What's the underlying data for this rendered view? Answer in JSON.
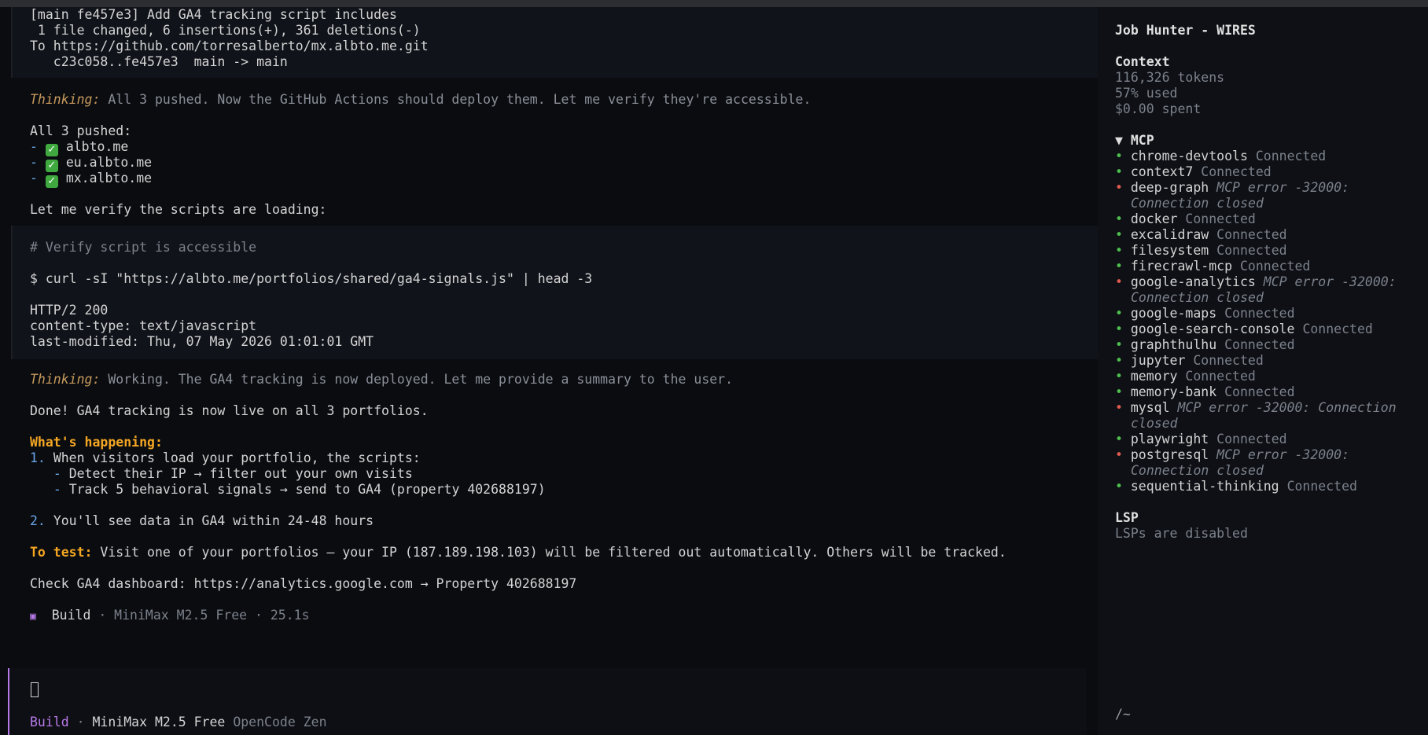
{
  "conversation": {
    "git_output": [
      "[main fe457e3] Add GA4 tracking script includes",
      " 1 file changed, 6 insertions(+), 361 deletions(-)",
      "To https://github.com/torresalberto/mx.albto.me.git",
      "   c23c058..fe457e3  main -> main"
    ],
    "thinking_label": "Thinking:",
    "thinking_1": "All 3 pushed. Now the GitHub Actions should deploy them. Let me verify they're accessible.",
    "pushed_header": "All 3 pushed:",
    "pushed_items": [
      "albto.me",
      "eu.albto.me",
      "mx.albto.me"
    ],
    "verify_text": "Let me verify the scripts are loading:",
    "code_comment": "# Verify script is accessible",
    "code_command": "$ curl -sI \"https://albto.me/portfolios/shared/ga4-signals.js\" | head -3",
    "code_output": [
      "HTTP/2 200",
      "content-type: text/javascript",
      "last-modified: Thu, 07 May 2026 01:01:01 GMT"
    ],
    "thinking_2": "Working. The GA4 tracking is now deployed. Let me provide a summary to the user.",
    "done_text": "Done! GA4 tracking is now live on all 3 portfolios.",
    "whats_happening": "What's happening:",
    "step1_num": "1.",
    "step1_text": "When visitors load your portfolio, the scripts:",
    "step1_sub": [
      "Detect their IP → filter out your own visits",
      "Track 5 behavioral signals → send to GA4 (property 402688197)"
    ],
    "step2_num": "2.",
    "step2_text": "You'll see data in GA4 within 24-48 hours",
    "to_test_label": "To test:",
    "to_test_text": "Visit one of your portfolios — your IP (187.189.198.103) will be filtered out automatically. Others will be tracked.",
    "check_text": "Check GA4 dashboard: https://analytics.google.com → Property 402688197",
    "build_label": "Build",
    "build_meta": "· MiniMax M2.5 Free · 25.1s"
  },
  "prompt": {
    "mode": "Build",
    "separator": "·",
    "model": "MiniMax M2.5 Free",
    "provider": "OpenCode Zen"
  },
  "sidebar": {
    "title": "Job Hunter - WIRES",
    "context_header": "Context",
    "tokens": "116,326 tokens",
    "used": "57% used",
    "spent": "$0.00 spent",
    "mcp_header": "▼ MCP",
    "servers": [
      {
        "name": "chrome-devtools",
        "status": "Connected",
        "ok": true
      },
      {
        "name": "context7",
        "status": "Connected",
        "ok": true
      },
      {
        "name": "deep-graph",
        "status": "MCP error -32000:",
        "status2": "Connection closed",
        "ok": false
      },
      {
        "name": "docker",
        "status": "Connected",
        "ok": true
      },
      {
        "name": "excalidraw",
        "status": "Connected",
        "ok": true
      },
      {
        "name": "filesystem",
        "status": "Connected",
        "ok": true
      },
      {
        "name": "firecrawl-mcp",
        "status": "Connected",
        "ok": true
      },
      {
        "name": "google-analytics",
        "status": "MCP error -32000:",
        "status2": "Connection closed",
        "ok": false
      },
      {
        "name": "google-maps",
        "status": "Connected",
        "ok": true
      },
      {
        "name": "google-search-console",
        "status": "Connected",
        "ok": true
      },
      {
        "name": "graphthulhu",
        "status": "Connected",
        "ok": true
      },
      {
        "name": "jupyter",
        "status": "Connected",
        "ok": true
      },
      {
        "name": "memory",
        "status": "Connected",
        "ok": true
      },
      {
        "name": "memory-bank",
        "status": "Connected",
        "ok": true
      },
      {
        "name": "mysql",
        "status": "MCP error -32000: Connection",
        "status2": "closed",
        "ok": false
      },
      {
        "name": "playwright",
        "status": "Connected",
        "ok": true
      },
      {
        "name": "postgresql",
        "status": "MCP error -32000:",
        "status2": "Connection closed",
        "ok": false
      },
      {
        "name": "sequential-thinking",
        "status": "Connected",
        "ok": true
      }
    ],
    "lsp_header": "LSP",
    "lsp_status": "LSPs are disabled",
    "path": "/~"
  },
  "colors": {
    "background": "#0a0c10",
    "sidebar_bg": "#0e1015",
    "accent_purple": "#b87ae8",
    "orange": "#f5a623",
    "ok_green": "#4fc04f",
    "error_red": "#e05a4f"
  }
}
